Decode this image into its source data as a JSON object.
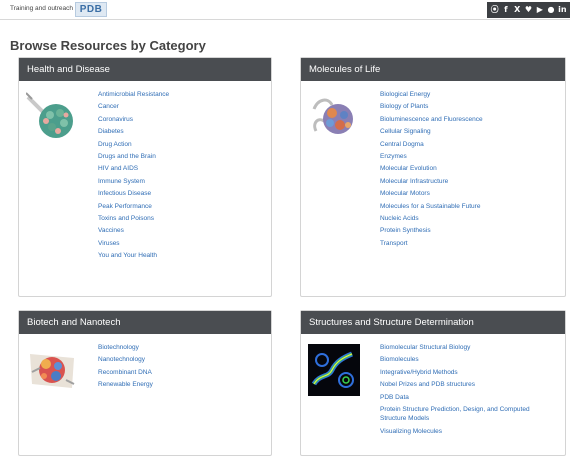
{
  "topbar": {
    "tagline": "Training and outreach portal of",
    "logo_text": "PDB",
    "social_icons": [
      {
        "name": "rss-icon",
        "glyph": "ʜ"
      },
      {
        "name": "facebook-icon",
        "glyph": "f"
      },
      {
        "name": "x-icon",
        "glyph": "X"
      },
      {
        "name": "bluesky-icon",
        "glyph": "♥"
      },
      {
        "name": "youtube-icon",
        "glyph": "▶"
      },
      {
        "name": "github-icon",
        "glyph": "●"
      },
      {
        "name": "linkedin-icon",
        "glyph": "in"
      }
    ]
  },
  "page_title": "Browse Resources by Category",
  "categories": {
    "health": {
      "title": "Health and Disease",
      "links": [
        "Antimicrobial Resistance",
        "Cancer",
        "Coronavirus",
        "Diabetes",
        "Drug Action",
        "Drugs and the Brain",
        "HIV and AIDS",
        "Immune System",
        "Infectious Disease",
        "Peak Performance",
        "Toxins and Poisons",
        "Vaccines",
        "Viruses",
        "You and Your Health"
      ]
    },
    "molecules": {
      "title": "Molecules of Life",
      "links": [
        "Biological Energy",
        "Biology of Plants",
        "Bioluminescence and Fluorescence",
        "Cellular Signaling",
        "Central Dogma",
        "Enzymes",
        "Molecular Evolution",
        "Molecular Infrastructure",
        "Molecular Motors",
        "Molecules for a Sustainable Future",
        "Nucleic Acids",
        "Protein Synthesis",
        "Transport"
      ]
    },
    "biotech": {
      "title": "Biotech and Nanotech",
      "links": [
        "Biotechnology",
        "Nanotechnology",
        "Recombinant DNA",
        "Renewable Energy"
      ]
    },
    "structures": {
      "title": "Structures and Structure Determination",
      "links": [
        "Biomolecular Structural Biology",
        "Biomolecules",
        "Integrative/Hybrid Methods",
        "Nobel Prizes and PDB structures",
        "PDB Data",
        "Protein Structure Prediction, Design, and Computed Structure Models",
        "Visualizing Molecules"
      ]
    }
  }
}
